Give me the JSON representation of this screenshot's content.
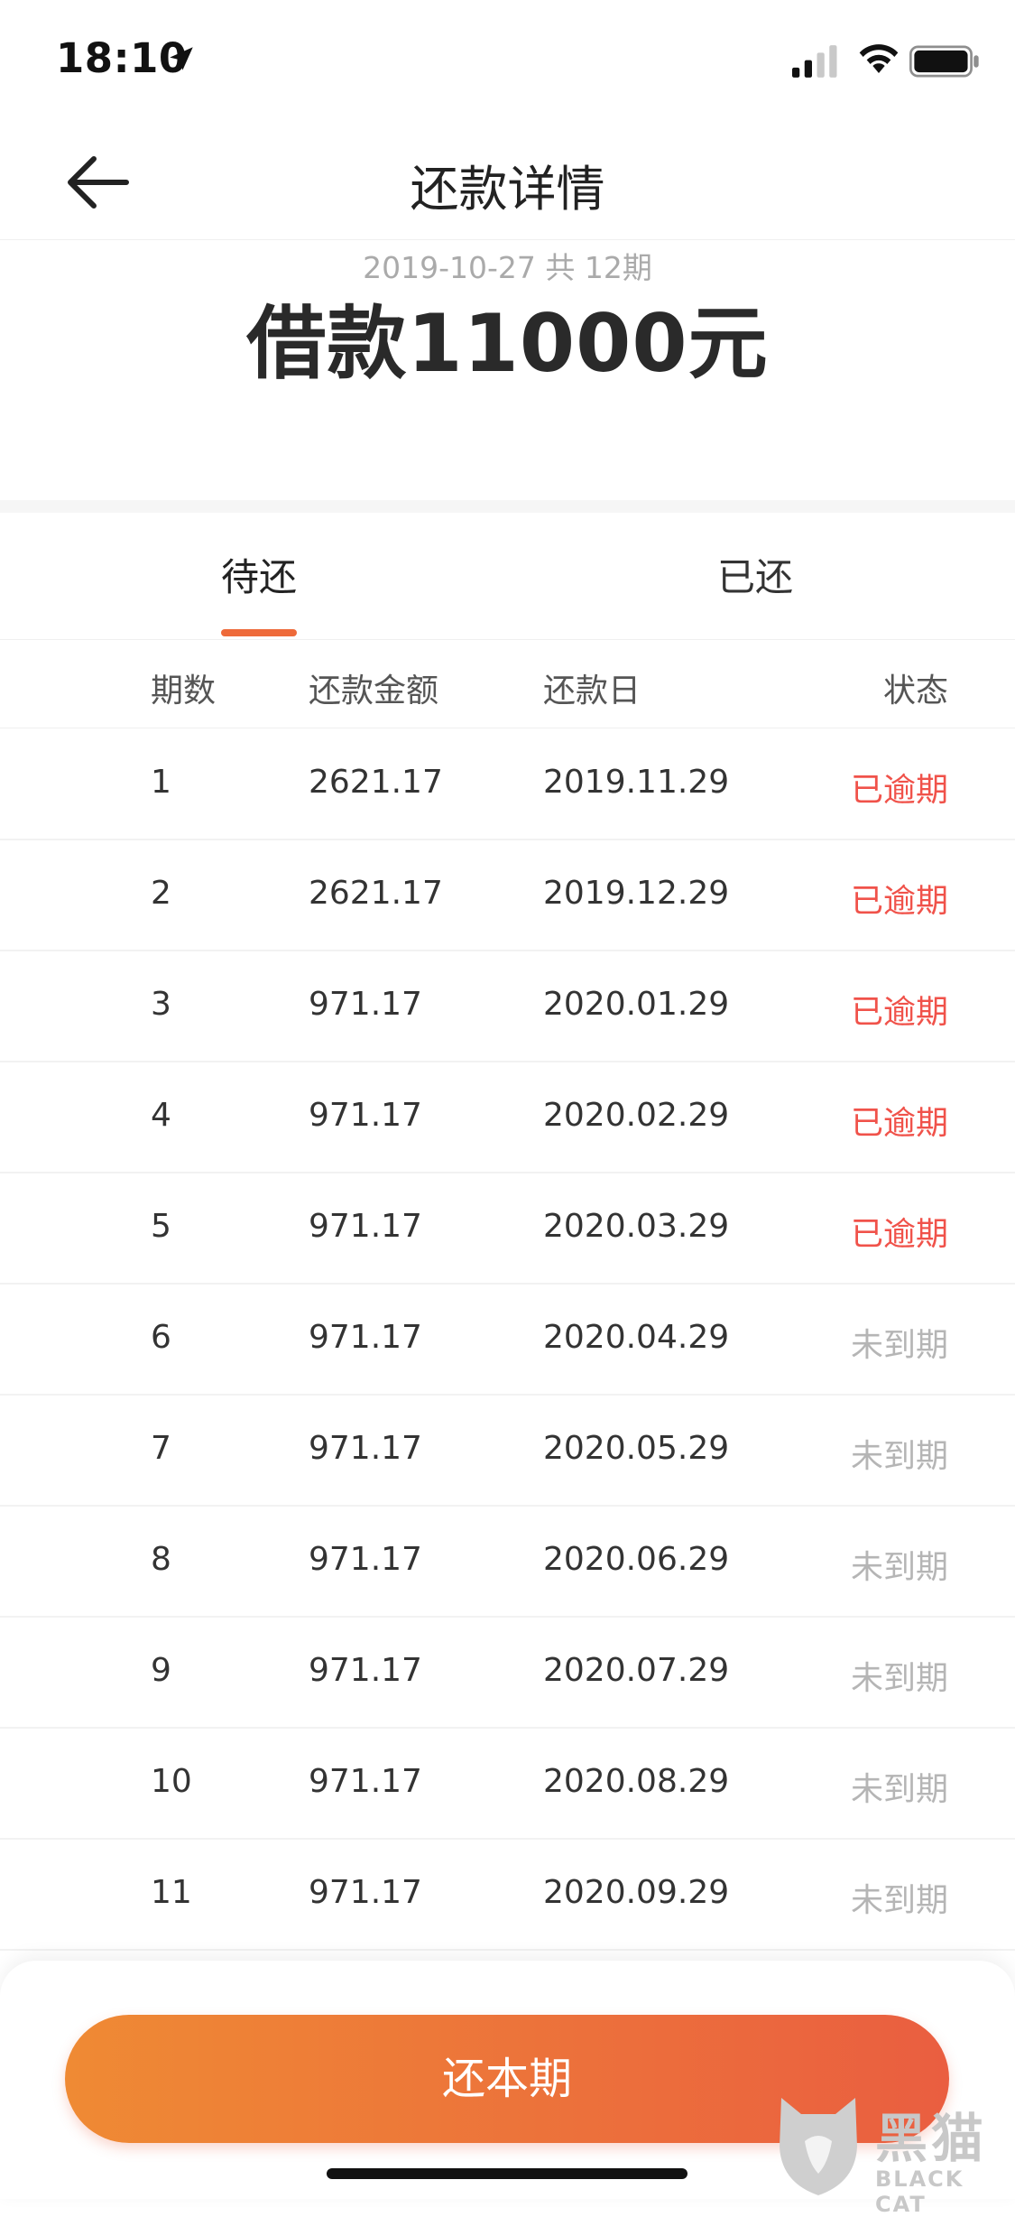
{
  "status_bar": {
    "time": "18:10"
  },
  "nav": {
    "title": "还款详情"
  },
  "loan": {
    "meta": "2019-10-27 共 12期",
    "amount_text": "借款11000元"
  },
  "tabs": [
    {
      "label": "待还"
    },
    {
      "label": "已还"
    }
  ],
  "table": {
    "headers": {
      "period": "期数",
      "amount": "还款金额",
      "date": "还款日",
      "status": "状态"
    },
    "rows": [
      {
        "period": "1",
        "amount": "2621.17",
        "date": "2019.11.29",
        "status": "已逾期",
        "overdue": true
      },
      {
        "period": "2",
        "amount": "2621.17",
        "date": "2019.12.29",
        "status": "已逾期",
        "overdue": true
      },
      {
        "period": "3",
        "amount": "971.17",
        "date": "2020.01.29",
        "status": "已逾期",
        "overdue": true
      },
      {
        "period": "4",
        "amount": "971.17",
        "date": "2020.02.29",
        "status": "已逾期",
        "overdue": true
      },
      {
        "period": "5",
        "amount": "971.17",
        "date": "2020.03.29",
        "status": "已逾期",
        "overdue": true
      },
      {
        "period": "6",
        "amount": "971.17",
        "date": "2020.04.29",
        "status": "未到期",
        "overdue": false
      },
      {
        "period": "7",
        "amount": "971.17",
        "date": "2020.05.29",
        "status": "未到期",
        "overdue": false
      },
      {
        "period": "8",
        "amount": "971.17",
        "date": "2020.06.29",
        "status": "未到期",
        "overdue": false
      },
      {
        "period": "9",
        "amount": "971.17",
        "date": "2020.07.29",
        "status": "未到期",
        "overdue": false
      },
      {
        "period": "10",
        "amount": "971.17",
        "date": "2020.08.29",
        "status": "未到期",
        "overdue": false
      },
      {
        "period": "11",
        "amount": "971.17",
        "date": "2020.09.29",
        "status": "未到期",
        "overdue": false
      }
    ]
  },
  "bottom": {
    "repay_label": "还本期"
  },
  "watermark": {
    "text": "黑猫",
    "sub": "BLACK CAT"
  },
  "colors": {
    "accent": "#ee6a3a",
    "overdue": "#f0524a",
    "not_due": "#b5b5b5"
  }
}
